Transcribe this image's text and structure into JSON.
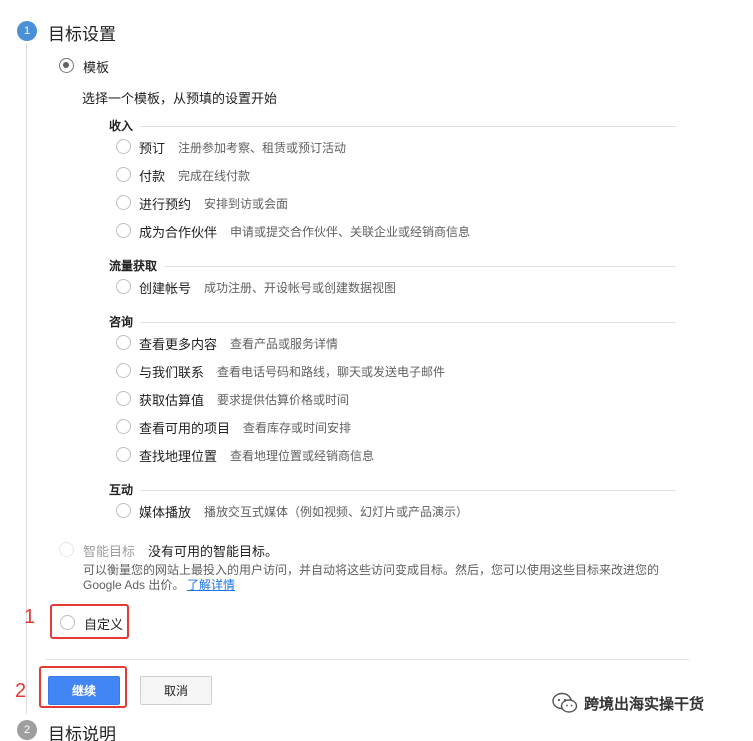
{
  "step1": {
    "number": "1",
    "title": "目标设置"
  },
  "step2": {
    "number": "2",
    "title": "目标说明"
  },
  "template": {
    "label": "模板",
    "subtitle": "选择一个模板，从预填的设置开始",
    "sections": [
      {
        "title": "收入",
        "items": [
          {
            "label": "预订",
            "desc": "注册参加考察、租赁或预订活动"
          },
          {
            "label": "付款",
            "desc": "完成在线付款"
          },
          {
            "label": "进行预约",
            "desc": "安排到访或会面"
          },
          {
            "label": "成为合作伙伴",
            "desc": "申请或提交合作伙伴、关联企业或经销商信息"
          }
        ]
      },
      {
        "title": "流量获取",
        "items": [
          {
            "label": "创建帐号",
            "desc": "成功注册、开设帐号或创建数据视图"
          }
        ]
      },
      {
        "title": "咨询",
        "items": [
          {
            "label": "查看更多内容",
            "desc": "查看产品或服务详情"
          },
          {
            "label": "与我们联系",
            "desc": "查看电话号码和路线，聊天或发送电子邮件"
          },
          {
            "label": "获取估算值",
            "desc": "要求提供估算价格或时间"
          },
          {
            "label": "查看可用的项目",
            "desc": "查看库存或时间安排"
          },
          {
            "label": "查找地理位置",
            "desc": "查看地理位置或经销商信息"
          }
        ]
      },
      {
        "title": "互动",
        "items": [
          {
            "label": "媒体播放",
            "desc": "播放交互式媒体（例如视频、幻灯片或产品演示）"
          }
        ]
      }
    ]
  },
  "smart": {
    "label": "智能目标",
    "status": "没有可用的智能目标。",
    "desc1": "可以衡量您的网站上最投入的用户访问，并自动将这些访问变成目标。然后，您可以使用这些目标来改进您的",
    "desc2": "Google Ads 出价。",
    "link": "了解详情"
  },
  "custom": {
    "label": "自定义"
  },
  "annotations": {
    "one": "1",
    "two": "2"
  },
  "buttons": {
    "continue": "继续",
    "cancel": "取消"
  },
  "watermark": {
    "text": "跨境出海实操干货"
  },
  "colors": {
    "primary": "#4285f4",
    "annotation": "#e53935",
    "step_active": "#4a90d9",
    "step_inactive": "#9e9e9e"
  }
}
